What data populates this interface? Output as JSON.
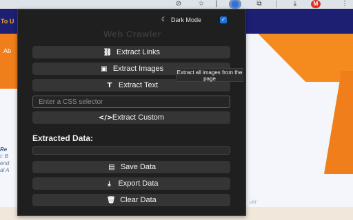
{
  "browser": {
    "profile_initial": "M",
    "icons": [
      "install-icon",
      "star-icon",
      "extension-icon",
      "puzzle-icon",
      "download-icon",
      "menu-icon"
    ]
  },
  "background_page": {
    "nav_link": "To U",
    "hero_text": "Ab",
    "card_lines": [
      "Re",
      "I: B",
      "end",
      "al A"
    ],
    "right_text": "uld"
  },
  "popup": {
    "dark_mode_label": "Dark Mode",
    "dark_mode_checked": true,
    "title": "Web Crawler",
    "buttons": {
      "extract_links": "Extract Links",
      "extract_images": "Extract Images",
      "extract_text": "Extract Text",
      "extract_custom": "Extract Custom",
      "save_data": "Save Data",
      "export_data": "Export Data",
      "clear_data": "Clear Data"
    },
    "css_selector_placeholder": "Enter a CSS selector",
    "extracted_label": "Extracted Data:",
    "tooltip": "Extract all images from the page",
    "colors": {
      "background": "#1f1f1f",
      "button": "#353535",
      "accent": "#1a73e8"
    }
  }
}
